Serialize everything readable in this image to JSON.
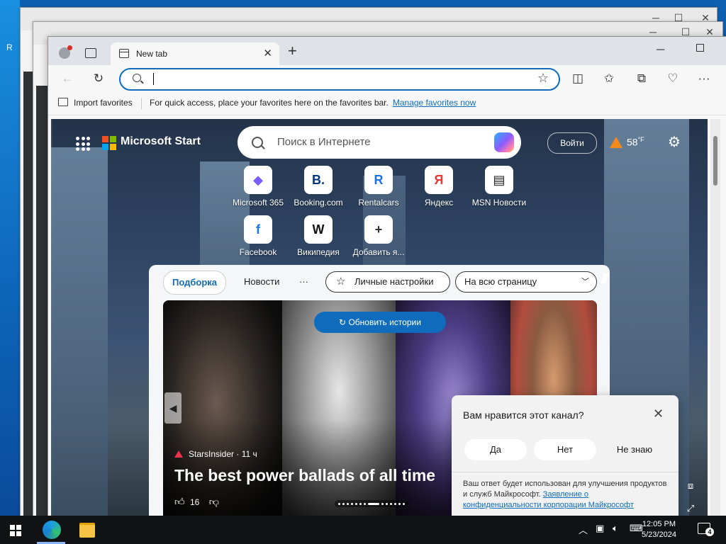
{
  "desktop": {
    "label": "R"
  },
  "window": {
    "tab_title": "New tab",
    "address": {
      "value": "",
      "placeholder": ""
    },
    "favorites_bar": {
      "import_label": "Import favorites",
      "hint": "For quick access, place your favorites here on the favorites bar.",
      "manage_link": "Manage favorites now"
    }
  },
  "start_page": {
    "brand": "Microsoft Start",
    "search_placeholder": "Поиск в Интернете",
    "login_label": "Войти",
    "weather": {
      "temp": "58",
      "unit": "°F"
    },
    "quick_links": [
      {
        "label": "Microsoft 365",
        "icon": "microsoft-365-icon",
        "glyph": "◆"
      },
      {
        "label": "Booking.com",
        "icon": "booking-icon",
        "glyph": "B."
      },
      {
        "label": "Rentalcars",
        "icon": "rentalcars-icon",
        "glyph": "R"
      },
      {
        "label": "Яндекс",
        "icon": "yandex-icon",
        "glyph": "Я"
      },
      {
        "label": "MSN Новости",
        "icon": "msn-news-icon",
        "glyph": "▤"
      },
      {
        "label": "Facebook",
        "icon": "facebook-icon",
        "glyph": "f"
      },
      {
        "label": "Википедия",
        "icon": "wikipedia-icon",
        "glyph": "W"
      },
      {
        "label": "Добавить я...",
        "icon": "add-icon",
        "glyph": "+"
      }
    ],
    "feed": {
      "tabs": [
        "Подборка",
        "Новости",
        "···"
      ],
      "personalize_label": "Личные настройки",
      "layout_select": "На всю страницу",
      "refresh_label": "Обновить истории",
      "story": {
        "source": "StarsInsider",
        "age": "11 ч",
        "title": "The best power ballads of all time",
        "likes": "16"
      }
    },
    "feedback": {
      "question": "Вам нравится этот канал?",
      "yes": "Да",
      "no": "Нет",
      "dont_know": "Не знаю",
      "note": "Ваш ответ будет использован для улучшения продуктов и служб Майкрософт.",
      "privacy_link": "Заявление о конфиденциальности корпорации Майкрософт"
    }
  },
  "taskbar": {
    "time": "12:05 PM",
    "date": "5/23/2024",
    "notifications": "4"
  },
  "colors": {
    "accent": "#0f6cbd",
    "taskbar": "#101214",
    "weather_icon": "#f28a1b"
  }
}
